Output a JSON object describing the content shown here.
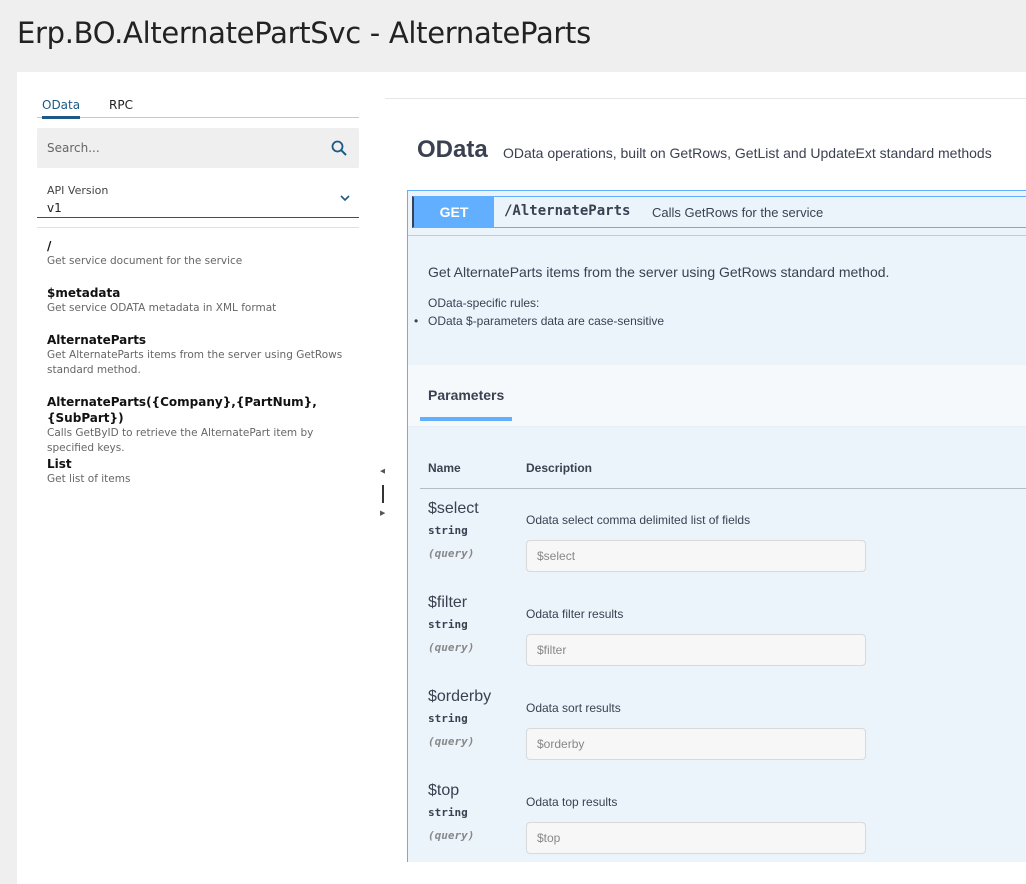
{
  "page": {
    "title": "Erp.BO.AlternatePartSvc - AlternateParts"
  },
  "sidebar": {
    "tabs": [
      {
        "label": "OData",
        "active": true
      },
      {
        "label": "RPC",
        "active": false
      }
    ],
    "search": {
      "placeholder": "Search..."
    },
    "api_version": {
      "label": "API Version",
      "value": "v1"
    },
    "endpoints": [
      {
        "title": "/",
        "desc": "Get service document for the service"
      },
      {
        "title": "$metadata",
        "desc": "Get service ODATA metadata in XML format"
      },
      {
        "title": "AlternateParts",
        "desc": "Get AlternateParts items from the server using GetRows standard method."
      },
      {
        "title": "AlternateParts({Company},{PartNum},{SubPart})",
        "desc": "Calls GetByID to retrieve the AlternatePart item by specified keys."
      },
      {
        "title": "List",
        "desc": "Get list of items"
      }
    ]
  },
  "main": {
    "section": {
      "title": "OData",
      "desc": "OData operations, built on GetRows, GetList and UpdateExt standard methods"
    },
    "operation": {
      "method": "GET",
      "path": "/AlternateParts",
      "summary": "Calls GetRows for the service",
      "description": "Get AlternateParts items from the server using GetRows standard method.",
      "rules_heading": "OData-specific rules:",
      "rules": [
        "OData $-parameters data are case-sensitive"
      ],
      "parameters_tab": "Parameters",
      "columns": {
        "name": "Name",
        "description": "Description"
      },
      "parameters": [
        {
          "name": "$select",
          "type": "string",
          "in": "(query)",
          "desc": "Odata select comma delimited list of fields",
          "placeholder": "$select"
        },
        {
          "name": "$filter",
          "type": "string",
          "in": "(query)",
          "desc": "Odata filter results",
          "placeholder": "$filter"
        },
        {
          "name": "$orderby",
          "type": "string",
          "in": "(query)",
          "desc": "Odata sort results",
          "placeholder": "$orderby"
        },
        {
          "name": "$top",
          "type": "string",
          "in": "(query)",
          "desc": "Odata top results",
          "placeholder": "$top"
        }
      ]
    }
  },
  "colors": {
    "get_accent": "#61affe",
    "link_blue": "#1b5a86",
    "op_bg": "#ebf3fb"
  },
  "icons": {
    "search": "search-icon",
    "chevron": "chevron-down-icon"
  }
}
